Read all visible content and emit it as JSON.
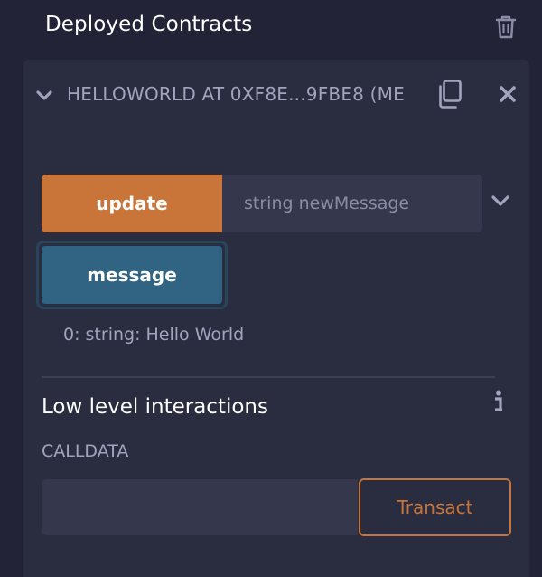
{
  "header": {
    "title": "Deployed Contracts",
    "clear_icon": "trash-icon"
  },
  "contract": {
    "title": "HELLOWORLD AT 0XF8E...9FBE8 (ME",
    "toggle_icon": "chevron-down-icon",
    "copy_icon": "copy-icon",
    "close_icon": "close-icon"
  },
  "functions": {
    "update": {
      "label": "update",
      "placeholder": "string newMessage",
      "value": "",
      "expand_icon": "chevron-down-icon"
    },
    "message": {
      "label": "message",
      "result": "0: string: Hello World"
    }
  },
  "low_level": {
    "title": "Low level interactions",
    "info_icon": "info-icon",
    "calldata_label": "CALLDATA",
    "calldata_value": "",
    "transact_label": "Transact"
  },
  "colors": {
    "background": "#222336",
    "panel": "#2a2c3f",
    "input": "#35384c",
    "accent_orange": "#c97539",
    "accent_blue": "#316382",
    "muted_text": "#a2a3bd"
  }
}
